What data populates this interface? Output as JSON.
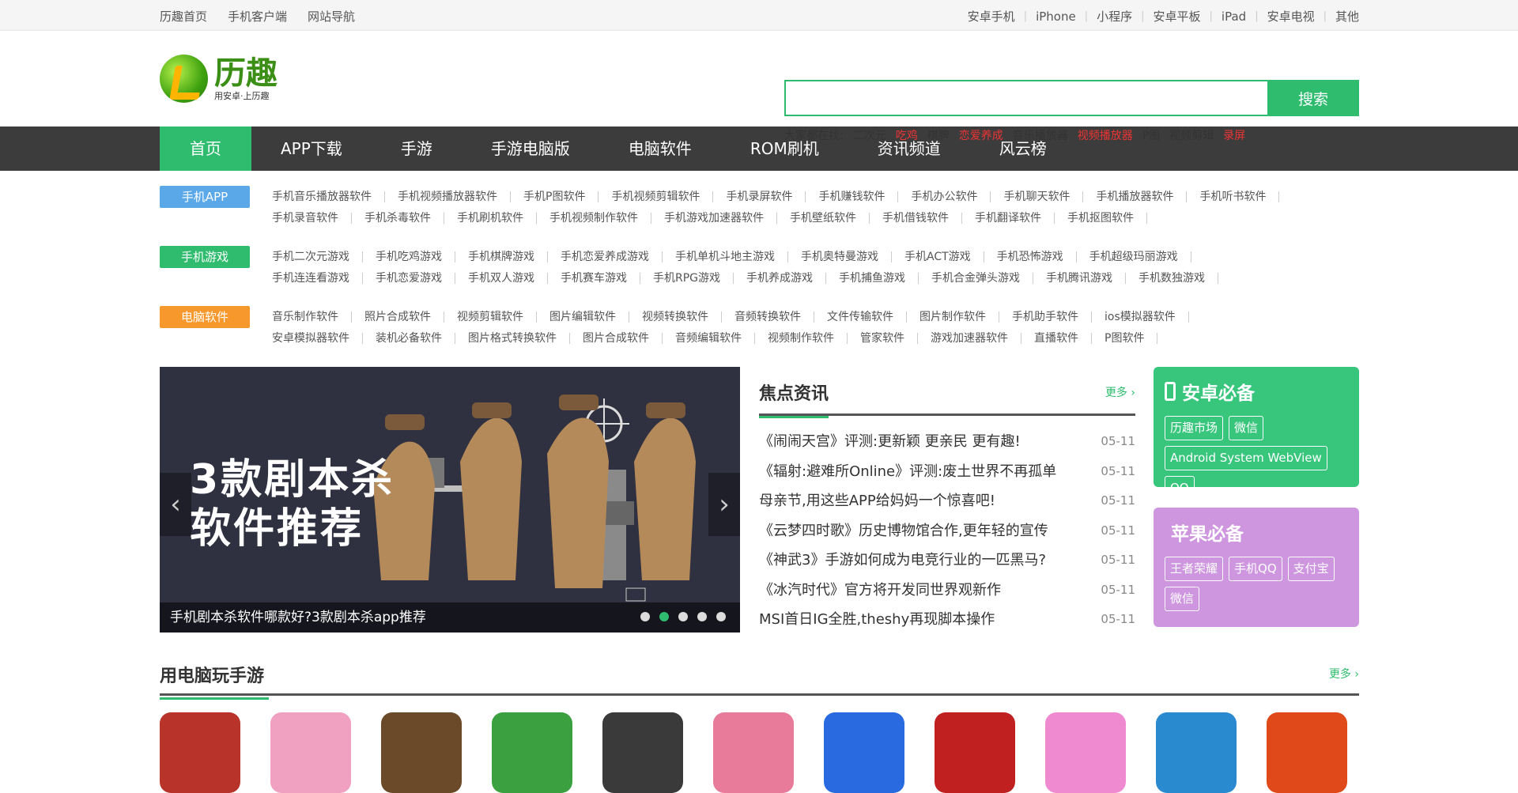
{
  "topbar": {
    "left": [
      "历趣首页",
      "手机客户端",
      "网站导航"
    ],
    "right": [
      "安卓手机",
      "iPhone",
      "小程序",
      "安卓平板",
      "iPad",
      "安卓电视",
      "其他"
    ]
  },
  "logo": {
    "name": "历趣",
    "slogan": "用安卓·上历趣"
  },
  "search": {
    "value": "",
    "button": "搜索",
    "hot_label": "大家都在找:",
    "hot": [
      {
        "t": "二次元",
        "red": false
      },
      {
        "t": "吃鸡",
        "red": true
      },
      {
        "t": "棋牌",
        "red": false
      },
      {
        "t": "恋爱养成",
        "red": true
      },
      {
        "t": "音乐播放器",
        "red": false
      },
      {
        "t": "视频播放器",
        "red": true
      },
      {
        "t": "P图",
        "red": false
      },
      {
        "t": "视频剪辑",
        "red": false
      },
      {
        "t": "录屏",
        "red": true
      }
    ]
  },
  "nav": [
    "首页",
    "APP下载",
    "手游",
    "手游电脑版",
    "电脑软件",
    "ROM刷机",
    "资讯频道",
    "风云榜"
  ],
  "categories": [
    {
      "tag": "手机APP",
      "color": "#5ba8e8",
      "links": [
        "手机音乐播放器软件",
        "手机视频播放器软件",
        "手机P图软件",
        "手机视频剪辑软件",
        "手机录屏软件",
        "手机赚钱软件",
        "手机办公软件",
        "手机聊天软件",
        "手机播放器软件",
        "手机听书软件",
        "手机录音软件",
        "手机杀毒软件",
        "手机刷机软件",
        "手机视频制作软件",
        "手机游戏加速器软件",
        "手机壁纸软件",
        "手机借钱软件",
        "手机翻译软件",
        "手机抠图软件"
      ]
    },
    {
      "tag": "手机游戏",
      "color": "#2fbc6e",
      "links": [
        "手机二次元游戏",
        "手机吃鸡游戏",
        "手机棋牌游戏",
        "手机恋爱养成游戏",
        "手机单机斗地主游戏",
        "手机奥特曼游戏",
        "手机ACT游戏",
        "手机恐怖游戏",
        "手机超级玛丽游戏",
        "手机连连看游戏",
        "手机恋爱游戏",
        "手机双人游戏",
        "手机赛车游戏",
        "手机RPG游戏",
        "手机养成游戏",
        "手机捕鱼游戏",
        "手机合金弹头游戏",
        "手机腾讯游戏",
        "手机数独游戏"
      ]
    },
    {
      "tag": "电脑软件",
      "color": "#f7982c",
      "links": [
        "音乐制作软件",
        "照片合成软件",
        "视频剪辑软件",
        "图片编辑软件",
        "视频转换软件",
        "音频转换软件",
        "文件传输软件",
        "图片制作软件",
        "手机助手软件",
        "ios模拟器软件",
        "安卓模拟器软件",
        "装机必备软件",
        "图片格式转换软件",
        "图片合成软件",
        "音频编辑软件",
        "视频制作软件",
        "管家软件",
        "游戏加速器软件",
        "直播软件",
        "P图软件"
      ]
    }
  ],
  "banner": {
    "title_line1": "3款剧本杀",
    "title_line2": "软件推荐",
    "caption": "手机剧本杀软件哪款好?3款剧本杀app推荐",
    "prev": "‹",
    "next": "›"
  },
  "news": {
    "title": "焦点资讯",
    "more": "更多 ›",
    "items": [
      {
        "t": "《闹闹天宫》评测:更新颖 更亲民 更有趣!",
        "d": "05-11"
      },
      {
        "t": "《辐射:避难所Online》评测:废土世界不再孤单",
        "d": "05-11"
      },
      {
        "t": "母亲节,用这些APP给妈妈一个惊喜吧!",
        "d": "05-11"
      },
      {
        "t": "《云梦四时歌》历史博物馆合作,更年轻的宣传",
        "d": "05-11"
      },
      {
        "t": "《神武3》手游如何成为电竞行业的一匹黑马?",
        "d": "05-11"
      },
      {
        "t": "《冰汽时代》官方将开发同世界观新作",
        "d": "05-11"
      },
      {
        "t": "MSI首日IG全胜,theshy再现脚本操作",
        "d": "05-11"
      }
    ]
  },
  "android": {
    "title": "安卓必备",
    "tags": [
      "历趣市场",
      "微信",
      "Android System WebView",
      "QQ"
    ]
  },
  "apple": {
    "title": "苹果必备",
    "tags": [
      "王者荣耀",
      "手机QQ",
      "支付宝",
      "微信"
    ]
  },
  "pc_games": {
    "title": "用电脑玩手游",
    "more": "更多 ›",
    "colors": [
      "#b8332a",
      "#f0a0c0",
      "#6b4a2a",
      "#3aa040",
      "#3a3a3a",
      "#e87a9a",
      "#2a6ae0",
      "#c02020",
      "#f08ad0",
      "#2a8ad0",
      "#e04a1a"
    ]
  }
}
